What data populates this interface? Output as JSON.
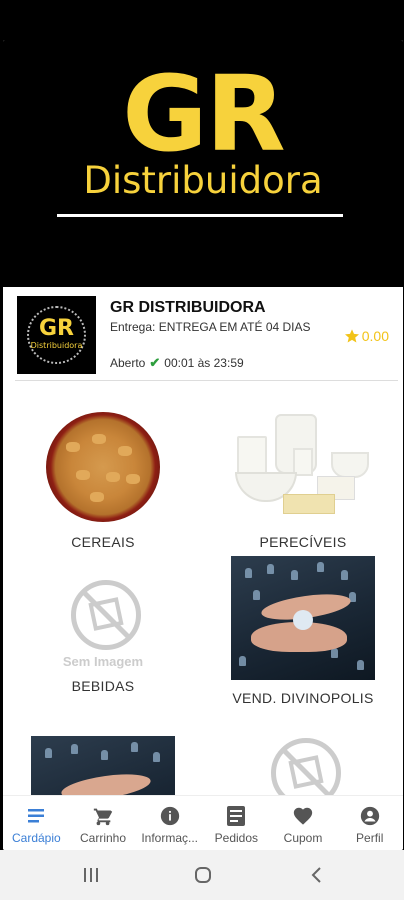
{
  "hero": {
    "brand": "GR",
    "subtitle": "Distribuidora"
  },
  "store": {
    "logo_brand": "GR",
    "logo_subtitle": "Distribuidora",
    "name": "GR DISTRIBUIDORA",
    "delivery": "Entrega: ENTREGA EM ATÉ 04 DIAS",
    "status": "Aberto",
    "hours": "00:01 às 23:59",
    "rating": "0.00"
  },
  "categories": [
    {
      "label": "CEREAIS",
      "image": "cereal-bowl"
    },
    {
      "label": "PERECÍVEIS",
      "image": "dairy-products"
    },
    {
      "label": "BEBIDAS",
      "image": "no-image",
      "placeholder": "Sem Imagem"
    },
    {
      "label": "VEND. DIVINOPOLIS",
      "image": "business-hands"
    },
    {
      "label": "",
      "image": "business-hands"
    },
    {
      "label": "",
      "image": "no-image"
    }
  ],
  "nav": [
    {
      "label": "Cardápio",
      "icon": "menu-list-icon",
      "active": true
    },
    {
      "label": "Carrinho",
      "icon": "cart-icon",
      "active": false
    },
    {
      "label": "Informaç...",
      "icon": "info-icon",
      "active": false
    },
    {
      "label": "Pedidos",
      "icon": "receipt-icon",
      "active": false
    },
    {
      "label": "Cupom",
      "icon": "heart-icon",
      "active": false
    },
    {
      "label": "Perfil",
      "icon": "person-icon",
      "active": false
    }
  ],
  "colors": {
    "brand_yellow": "#f7d23c",
    "active_blue": "#3b7fd6",
    "star": "#f2c318",
    "check": "#2e9e3e"
  }
}
